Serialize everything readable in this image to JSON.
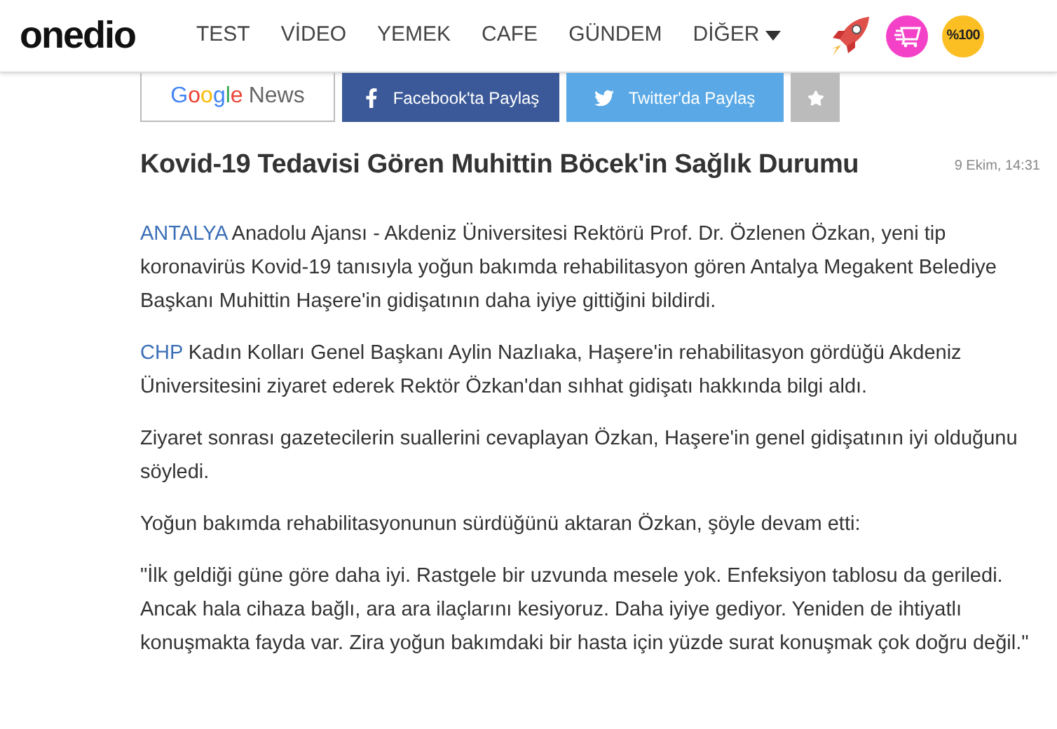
{
  "header": {
    "logo": "onedio",
    "nav": [
      {
        "label": "TEST",
        "kind": "link"
      },
      {
        "label": "VİDEO",
        "kind": "link"
      },
      {
        "label": "YEMEK",
        "kind": "link"
      },
      {
        "label": "CAFE",
        "kind": "link"
      },
      {
        "label": "GÜNDEM",
        "kind": "link"
      },
      {
        "label": "DİĞER",
        "kind": "dropdown"
      }
    ],
    "badge": "%100"
  },
  "share": {
    "google": [
      "Google",
      "News"
    ],
    "facebook": "Facebook'ta Paylaş",
    "twitter": "Twitter'da Paylaş"
  },
  "article": {
    "title": "Kovid-19 Tedavisi Gören Muhittin Böcek'in Sağlık Durumu",
    "date": "9 Ekim, 14:31",
    "paragraphs": [
      {
        "link": "ANTALYA",
        "text": "Anadolu Ajansı - Akdeniz Üniversitesi Rektörü Prof. Dr. Özlenen Özkan, yeni tip koronavirüs Kovid-19 tanısıyla yoğun bakımda rehabilitasyon gören Antalya Megakent Belediye Başkanı Muhittin Haşere'in gidişatının daha iyiye gittiğini bildirdi."
      },
      {
        "link": "CHP",
        "text": "Kadın Kolları Genel Başkanı Aylin Nazlıaka, Haşere'in rehabilitasyon gördüğü Akdeniz Üniversitesini ziyaret ederek Rektör Özkan'dan sıhhat gidişatı hakkında bilgi aldı."
      },
      {
        "text": "Ziyaret sonrası gazetecilerin suallerini cevaplayan Özkan, Haşere'in genel gidişatının iyi olduğunu söyledi."
      },
      {
        "text": "Yoğun bakımda rehabilitasyonunun sürdüğünü aktaran Özkan, şöyle devam etti:"
      },
      {
        "text": "\"İlk geldiği güne göre daha iyi. Rastgele bir uzvunda mesele yok. Enfeksiyon tablosu da geriledi. Ancak hala cihaza bağlı, ara ara ilaçlarını kesiyoruz. Daha iyiye gediyor. Yeniden de ihtiyatlı konuşmakta fayda var. Zira yoğun bakımdaki bir hasta için yüzde surat konuşmak çok doğru değil.\""
      }
    ]
  }
}
